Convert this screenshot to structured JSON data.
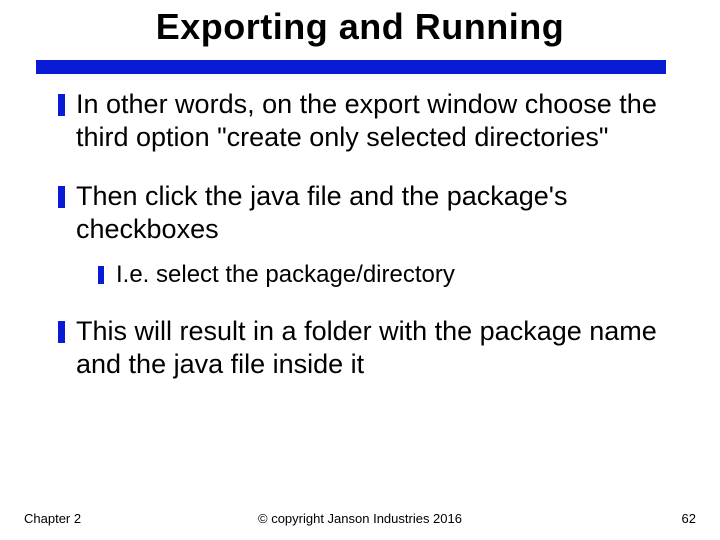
{
  "title": "Exporting and Running",
  "bullets": [
    "In other words, on the export window choose the third option \"create only selected directories\"",
    "Then click the java file and the package's checkboxes",
    "This will result in a folder with the package name and the java file inside it"
  ],
  "sub_bullet": "I.e. select the package/directory",
  "footer": {
    "left": "Chapter 2",
    "center": "© copyright Janson Industries 2016",
    "right": "62"
  },
  "colors": {
    "accent": "#0a1bd6"
  }
}
